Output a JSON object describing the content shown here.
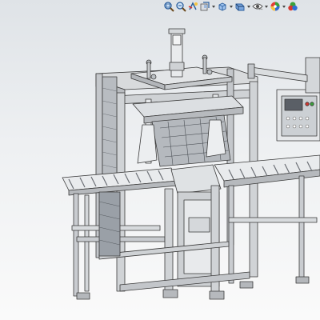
{
  "toolbar": {
    "buttons": [
      {
        "icon": "zoom-to-fit-icon"
      },
      {
        "icon": "zoom-to-area-icon"
      },
      {
        "icon": "previous-view-icon"
      },
      {
        "icon": "section-view-icon"
      },
      {
        "icon": "view-orientation-icon",
        "dropdown": true
      },
      {
        "icon": "display-style-icon",
        "dropdown": true
      },
      {
        "icon": "hide-show-items-icon",
        "dropdown": true
      },
      {
        "icon": "edit-appearance-icon",
        "dropdown": true
      },
      {
        "icon": "apply-scene-icon",
        "dropdown": true
      }
    ]
  },
  "colors": {
    "background_top": "#dfe3e7",
    "background_bottom": "#fafafa",
    "frame": "#c9ccd0",
    "edge": "#3a3a3a",
    "panel": "#e4e6e8",
    "dark_panel": "#5a5f66",
    "accent_red": "#d6362f",
    "accent_green": "#3aa23a",
    "accent_blue": "#2f6fd6"
  },
  "model": {
    "description_visible": false
  }
}
